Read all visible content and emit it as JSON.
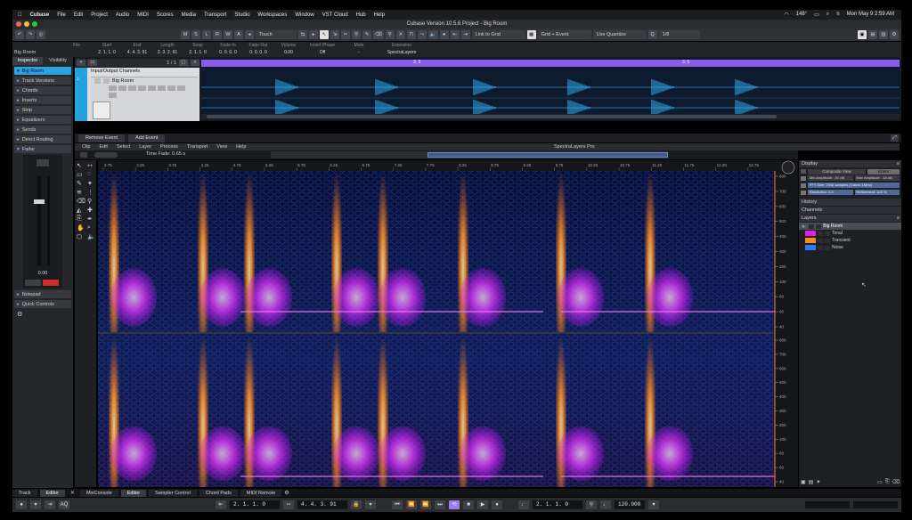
{
  "menubar": {
    "app_name": "Cubase",
    "items": [
      "File",
      "Edit",
      "Project",
      "Audio",
      "MIDI",
      "Scores",
      "Media",
      "Transport",
      "Studio",
      "Workspaces",
      "Window",
      "VST Cloud",
      "Hub",
      "Help"
    ],
    "temperature": "148°",
    "clock": "Mon May 9  2:59 AM"
  },
  "window": {
    "title": "Cubase Version 10.5.6 Project - Big Room"
  },
  "toolbar": {
    "automation_mode": "Touch",
    "snap_mode": "Link to Grid",
    "grid_mode": "Grid + Event",
    "quantize_mode": "Use Quantize",
    "quantize_value": "1/8",
    "msrw": [
      "M",
      "S",
      "L",
      "R",
      "W",
      "A"
    ]
  },
  "infoline": {
    "track_name": "Big Room",
    "columns": [
      {
        "label": "File",
        "value": ""
      },
      {
        "label": "Start",
        "value": "2. 1. 1.  0"
      },
      {
        "label": "End",
        "value": "4. 4. 3. 91"
      },
      {
        "label": "Length",
        "value": "2. 3. 2. 91"
      },
      {
        "label": "Snap",
        "value": "2. 1. 1.  0"
      },
      {
        "label": "Fade-In",
        "value": "0. 0. 0.  0"
      },
      {
        "label": "Fade-Out",
        "value": "0. 0. 0.  0"
      },
      {
        "label": "Volume",
        "value": "0.00"
      },
      {
        "label": "Invert Phase",
        "value": "Off"
      },
      {
        "label": "Mute",
        "value": "-"
      },
      {
        "label": "Extension",
        "value": "SpectraLayers"
      }
    ]
  },
  "inspector": {
    "tabs": [
      "Inspector",
      "Visibility"
    ],
    "track_name": "Big Room",
    "sections": [
      "Track Versions",
      "Chords",
      "Inserts",
      "Strip",
      "Equalizers",
      "Sends",
      "Direct Routing",
      "Fader"
    ],
    "fader_value": "0.00",
    "notepad": "Notepad",
    "quick_controls": "Quick Controls"
  },
  "project": {
    "bar_display": "1 / 1",
    "folder": "Input/Output Channels",
    "track_name": "Big Room",
    "ruler_marks": [
      "3. 3",
      "3. 5"
    ]
  },
  "editor_tabs": [
    "Remove Event",
    "Add Event"
  ],
  "spectralayers": {
    "menu": [
      "Clip",
      "Edit",
      "Select",
      "Layer",
      "Process",
      "Transport",
      "View",
      "Help"
    ],
    "title": "SpectraLayers Pro",
    "time_fade": "Time Fade: 0.65 s",
    "ruler_ticks": [
      "2.75",
      "3",
      "3.25",
      "3.5",
      "3.75",
      "4",
      "4.25",
      "4.5",
      "4.75",
      "5",
      "5.25",
      "5.5",
      "5.75",
      "6",
      "6.25",
      "6.5",
      "6.75",
      "7",
      "7.25",
      "7.5",
      "7.75",
      "8",
      "8.25",
      "8.5",
      "8.75",
      "9",
      "9.25",
      "9.5",
      "9.75",
      "10",
      "10.25",
      "10.5",
      "10.75",
      "11",
      "11.25",
      "11.5",
      "11.75",
      "12",
      "12.25",
      "12.5",
      "12.75",
      "13"
    ],
    "freq_ticks": [
      "800",
      "700",
      "600",
      "500",
      "400",
      "300",
      "200",
      "100",
      "80",
      "60",
      "40"
    ]
  },
  "display_panel": {
    "header": "Display",
    "composite": "Composite View",
    "linear": "Linear",
    "min_amp": "Min Amplitude: -91 dB",
    "max_amp": "Max Amplitude: -18 dB",
    "fft": "FFT Size: 2048 samples (Gauss 1MHz)",
    "resolution": "Resolution: 4.0",
    "refinement": "Refinement: 100 %"
  },
  "side_panels": {
    "history": "History",
    "channels": "Channels",
    "layers": "Layers"
  },
  "layers": [
    {
      "name": "Big Room",
      "color": "#5a5d63"
    },
    {
      "name": "Tonal",
      "color": "#e020e8"
    },
    {
      "name": "Transient",
      "color": "#ff8a1a"
    },
    {
      "name": "Noise",
      "color": "#2a7cff"
    }
  ],
  "bottom_tabs": [
    "Track",
    "Editor",
    "MixConsole",
    "Editor",
    "Sampler Control",
    "Chord Pads",
    "MIDI Remote"
  ],
  "transport": {
    "mode": "AQ",
    "left_locator": "2. 1. 1.  0",
    "right_locator": "4. 4. 3. 91",
    "position": "2. 1. 1.  0",
    "tempo": "120.000"
  },
  "colors": {
    "accent": "#8c5ce8",
    "track_blue": "#22a3e0",
    "waveform": "#2fb6ff"
  }
}
